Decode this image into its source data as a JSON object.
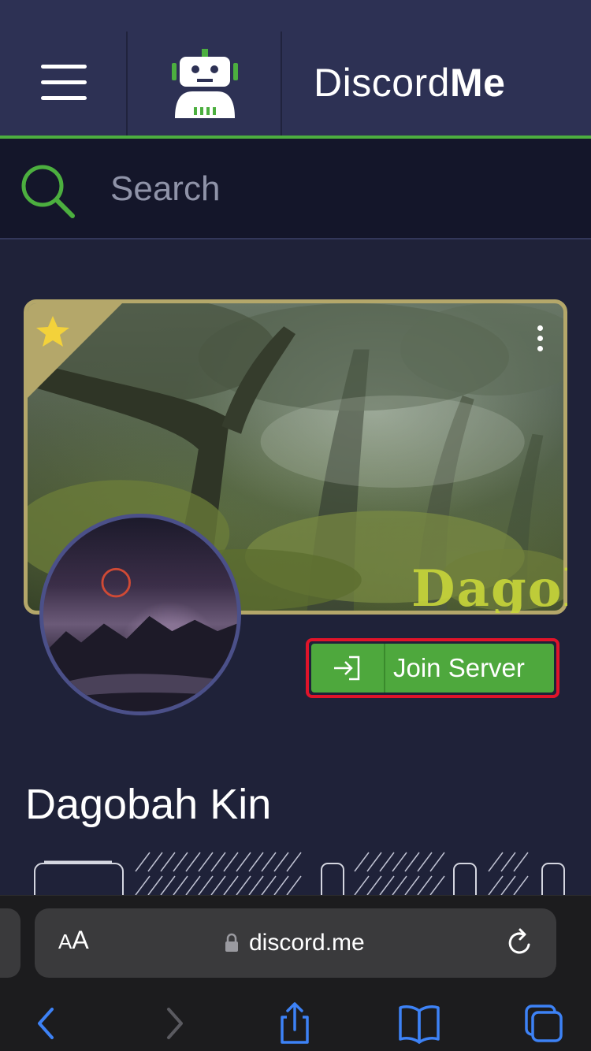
{
  "header": {
    "logo_text_regular": "Discord",
    "logo_text_bold": "Me"
  },
  "search": {
    "placeholder": "Search"
  },
  "server": {
    "name": "Dagobah Kin",
    "join_label": "Join Server",
    "banner_watermark": "Dagol",
    "featured": true
  },
  "browser": {
    "text_size_label_small": "A",
    "text_size_label_large": "A",
    "url": "discord.me"
  },
  "colors": {
    "header_bg": "#2d3154",
    "accent_green": "#4caf3f",
    "join_button": "#4ea83d",
    "highlight_border": "#e0142a",
    "banner_border": "#b4a76a",
    "safari_blue": "#3d82f6"
  },
  "icons": {
    "menu": "hamburger-icon",
    "bot": "robot-icon",
    "search": "search-icon",
    "featured": "star-icon",
    "more": "kebab-icon",
    "join": "login-arrow-icon",
    "lock": "lock-icon",
    "reload": "reload-icon",
    "back": "chevron-left-icon",
    "forward": "chevron-right-icon",
    "share": "share-icon",
    "bookmarks": "book-icon",
    "tabs": "tabs-icon"
  }
}
